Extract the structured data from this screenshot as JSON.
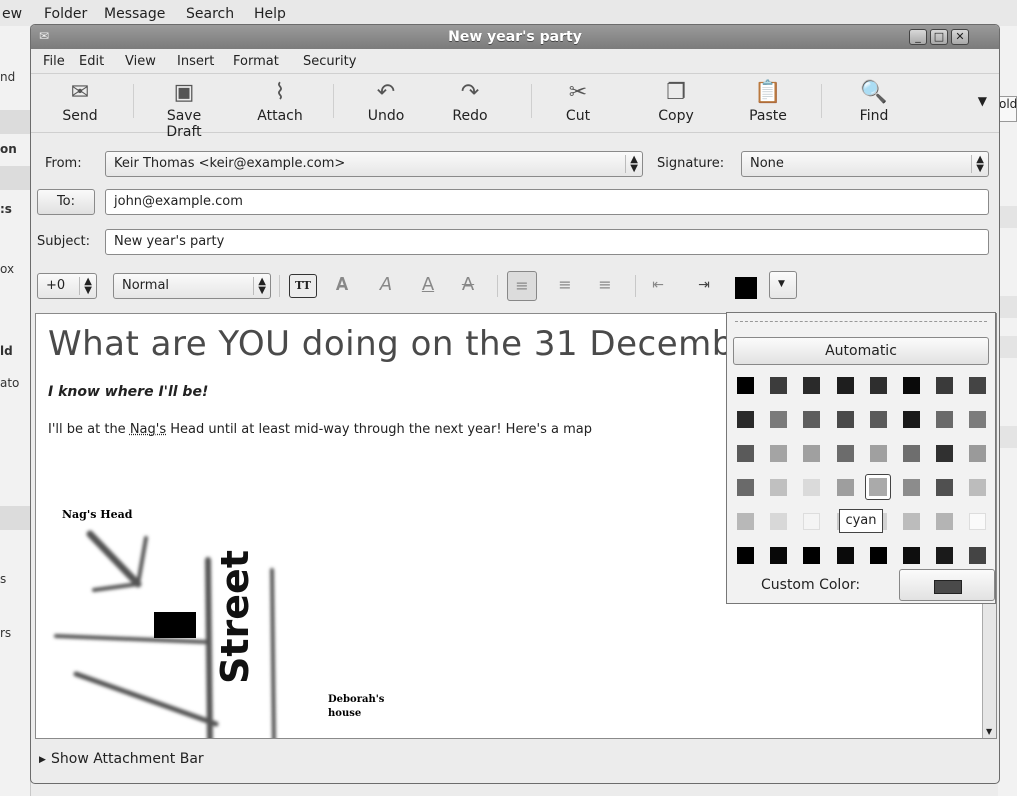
{
  "bg_menu": [
    "ew",
    "Folder",
    "Message",
    "Search",
    "Help"
  ],
  "bg_side_labels": [
    "nd",
    "on",
    ":s",
    "ox",
    "ld",
    "ato",
    "s",
    "rs"
  ],
  "bg_right_fragment": "old",
  "window": {
    "title": "New year's party"
  },
  "menu": [
    "File",
    "Edit",
    "View",
    "Insert",
    "Format",
    "Security"
  ],
  "toolbar": {
    "send": "Send",
    "save_draft": "Save Draft",
    "attach": "Attach",
    "undo": "Undo",
    "redo": "Redo",
    "cut": "Cut",
    "copy": "Copy",
    "paste": "Paste",
    "find": "Find"
  },
  "headers": {
    "from_label": "From:",
    "from_value": "Keir Thomas <keir@example.com>",
    "signature_label": "Signature:",
    "signature_value": "None",
    "to_label": "To:",
    "to_value": "john@example.com",
    "subject_label": "Subject:",
    "subject_value": "New year's party"
  },
  "format": {
    "size_value": "+0",
    "style_value": "Normal",
    "current_color": "#000000"
  },
  "body": {
    "heading": "What are YOU doing on the 31 December?",
    "italic_line": "I know where I'll be!",
    "paragraph_pre": "I'll be at the ",
    "paragraph_link": "Nag's",
    "paragraph_post": " Head until at least mid-way through the next year!  Here's a map",
    "map_label_nags": "Nag's Head",
    "map_label_street": "Street",
    "map_label_deborah_1": "Deborah's",
    "map_label_deborah_2": "house"
  },
  "color_popup": {
    "automatic": "Automatic",
    "custom_label": "Custom Color:",
    "hover_tooltip": "cyan",
    "custom_color": "#4a4a4a",
    "rows": [
      [
        "#000000",
        "#3c3c3c",
        "#2a2a2a",
        "#1e1e1e",
        "#2e2e2e",
        "#0a0a0a",
        "#3a3a3a",
        "#444444"
      ],
      [
        "#2a2a2a",
        "#7a7a7a",
        "#5e5e5e",
        "#4a4a4a",
        "#5a5a5a",
        "#1a1a1a",
        "#6a6a6a",
        "#7c7c7c"
      ],
      [
        "#5a5a5a",
        "#a4a4a4",
        "#a0a0a0",
        "#6c6c6c",
        "#a0a0a0",
        "#6e6e6e",
        "#303030",
        "#9a9a9a"
      ],
      [
        "#6a6a6a",
        "#c0c0c0",
        "#dadada",
        "#9e9e9e",
        "#aaaaaa",
        "#8c8c8c",
        "#505050",
        "#bcbcbc"
      ],
      [
        "#b8b8b8",
        "#d8d8d8",
        "#f4f4f4",
        "#cacaca",
        "#d2d2d2",
        "#bcbcbc",
        "#b4b4b4",
        "#fafafa"
      ],
      [
        "#000000",
        "#080808",
        "#000000",
        "#0a0a0a",
        "#000000",
        "#0e0e0e",
        "#1a1a1a",
        "#444444"
      ]
    ]
  },
  "attachment": {
    "label": "Show Attachment Bar"
  }
}
